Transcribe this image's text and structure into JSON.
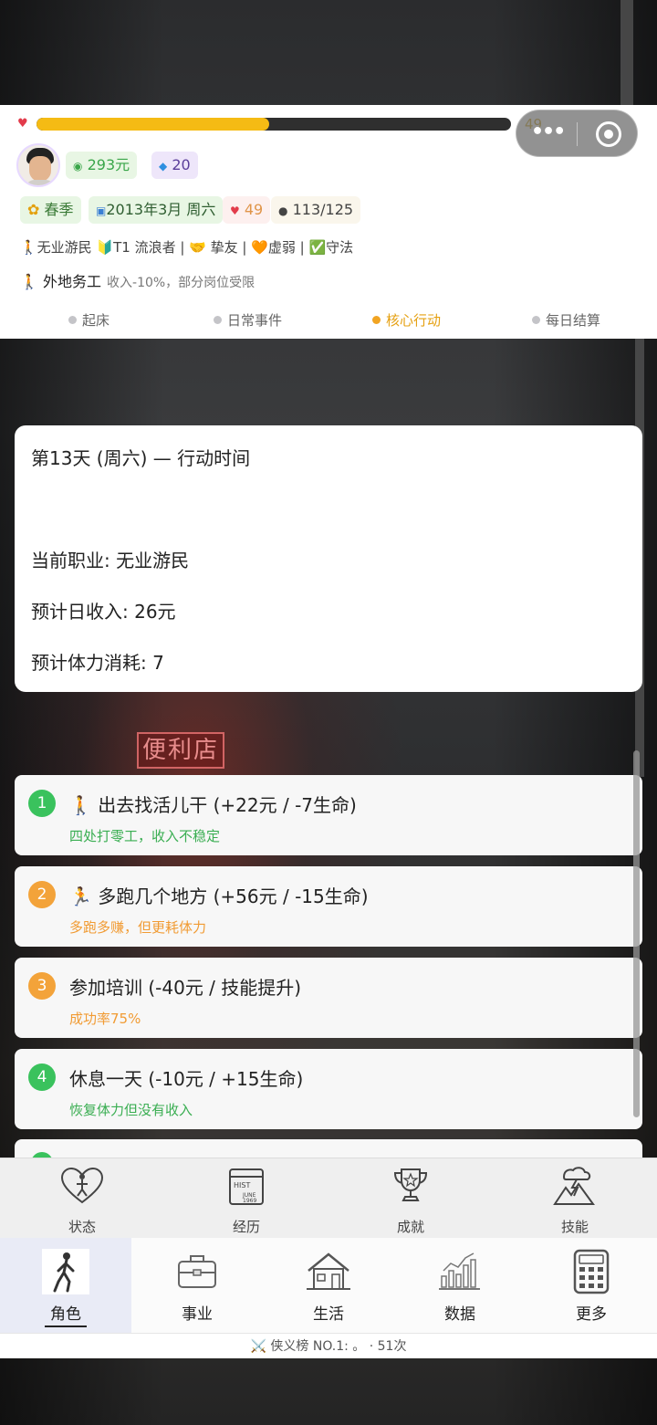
{
  "header": {
    "hp_value": 49,
    "hp_fraction": 0.49,
    "money": "293元",
    "gems": "20",
    "season": "春季",
    "date": "2013年3月 周六",
    "health": "49",
    "energy": "113/125",
    "status_text": "🚶无业游民 🔰T1 流浪者 | 🤝 挚友 | 🧡虚弱 | ✅守法",
    "debuff_title": "🚶 外地务工",
    "debuff_desc": "收入-10%，部分岗位受限"
  },
  "phases": [
    {
      "label": "起床",
      "active": false
    },
    {
      "label": "日常事件",
      "active": false
    },
    {
      "label": "核心行动",
      "active": true
    },
    {
      "label": "每日结算",
      "active": false
    }
  ],
  "info": {
    "title": "第13天 (周六) — 行动时间",
    "occupation": "当前职业: 无业游民",
    "income": "预计日收入: 26元",
    "stamina": "预计体力消耗: 7"
  },
  "choices": [
    {
      "num": "1",
      "title": "🚶 出去找活儿干 (+22元 / -7生命)",
      "sub": "四处打零工，收入不稳定",
      "color": "#3ac25d"
    },
    {
      "num": "2",
      "title": "🏃 多跑几个地方 (+56元 / -15生命)",
      "sub": "多跑多赚，但更耗体力",
      "color": "#f3a33a"
    },
    {
      "num": "3",
      "title": "参加培训 (-40元 / 技能提升)",
      "sub": "成功率75%",
      "color": "#f3a33a"
    },
    {
      "num": "4",
      "title": "休息一天 (-10元 / +15生命)",
      "sub": "恢复体力但没有收入",
      "color": "#3ac25d"
    }
  ],
  "subnav": [
    {
      "label": "状态",
      "icon": "heart-person-icon"
    },
    {
      "label": "经历",
      "icon": "history-calendar-icon"
    },
    {
      "label": "成就",
      "icon": "trophy-icon"
    },
    {
      "label": "技能",
      "icon": "mountain-lightning-icon"
    }
  ],
  "mainnav": [
    {
      "label": "角色",
      "icon": "walking-person-icon",
      "active": true
    },
    {
      "label": "事业",
      "icon": "briefcase-icon",
      "active": false
    },
    {
      "label": "生活",
      "icon": "house-icon",
      "active": false
    },
    {
      "label": "数据",
      "icon": "bar-chart-icon",
      "active": false
    },
    {
      "label": "更多",
      "icon": "calculator-grid-icon",
      "active": false
    }
  ],
  "ticker": "⚔️ 侠义榜 NO.1: 。 · 51次"
}
